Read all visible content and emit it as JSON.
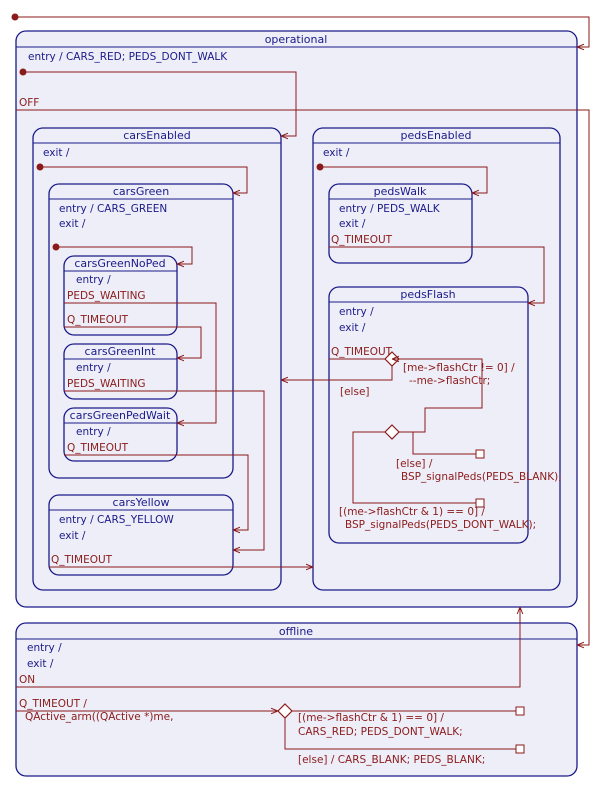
{
  "states": {
    "operational": {
      "name": "operational",
      "entry": "entry / CARS_RED; PEDS_DONT_WALK",
      "off_trigger": "OFF"
    },
    "carsEnabled": {
      "name": "carsEnabled",
      "exit": "exit /"
    },
    "carsGreen": {
      "name": "carsGreen",
      "entry": "entry / CARS_GREEN",
      "exit": "exit /"
    },
    "carsGreenNoPed": {
      "name": "carsGreenNoPed",
      "entry": "entry /",
      "trigger1": "PEDS_WAITING",
      "trigger2": "Q_TIMEOUT"
    },
    "carsGreenInt": {
      "name": "carsGreenInt",
      "entry": "entry /",
      "trigger": "PEDS_WAITING"
    },
    "carsGreenPedWait": {
      "name": "carsGreenPedWait",
      "entry": "entry /",
      "trigger": "Q_TIMEOUT"
    },
    "carsYellow": {
      "name": "carsYellow",
      "entry": "entry / CARS_YELLOW",
      "exit": "exit /",
      "trigger": "Q_TIMEOUT"
    },
    "pedsEnabled": {
      "name": "pedsEnabled",
      "exit": "exit /"
    },
    "pedsWalk": {
      "name": "pedsWalk",
      "entry": "entry / PEDS_WALK",
      "exit": "exit /",
      "trigger": "Q_TIMEOUT"
    },
    "pedsFlash": {
      "name": "pedsFlash",
      "entry": "entry /",
      "exit": "exit /",
      "trigger": "Q_TIMEOUT",
      "guard1_line1": "[me->flashCtr != 0] /",
      "guard1_line2": "--me->flashCtr;",
      "else1": "[else]",
      "else2_line1": "[else] /",
      "else2_line2": "BSP_signalPeds(PEDS_BLANK);",
      "guard2_line1": "[(me->flashCtr & 1) == 0] /",
      "guard2_line2": "BSP_signalPeds(PEDS_DONT_WALK);"
    },
    "offline": {
      "name": "offline",
      "entry": "entry /",
      "exit": "exit /",
      "on_trigger": "ON",
      "timeout_line1": "Q_TIMEOUT /",
      "timeout_line2": "QActive_arm((QActive *)me,",
      "guard_line1": "[(me->flashCtr & 1) == 0] /",
      "guard_line2": "CARS_RED; PEDS_DONT_WALK;",
      "else_line": "[else] / CARS_BLANK; PEDS_BLANK;"
    }
  },
  "colors": {
    "state_border": "#1a1a8a",
    "state_fill": "#eeeef8",
    "transition": "#8b1a1a"
  }
}
